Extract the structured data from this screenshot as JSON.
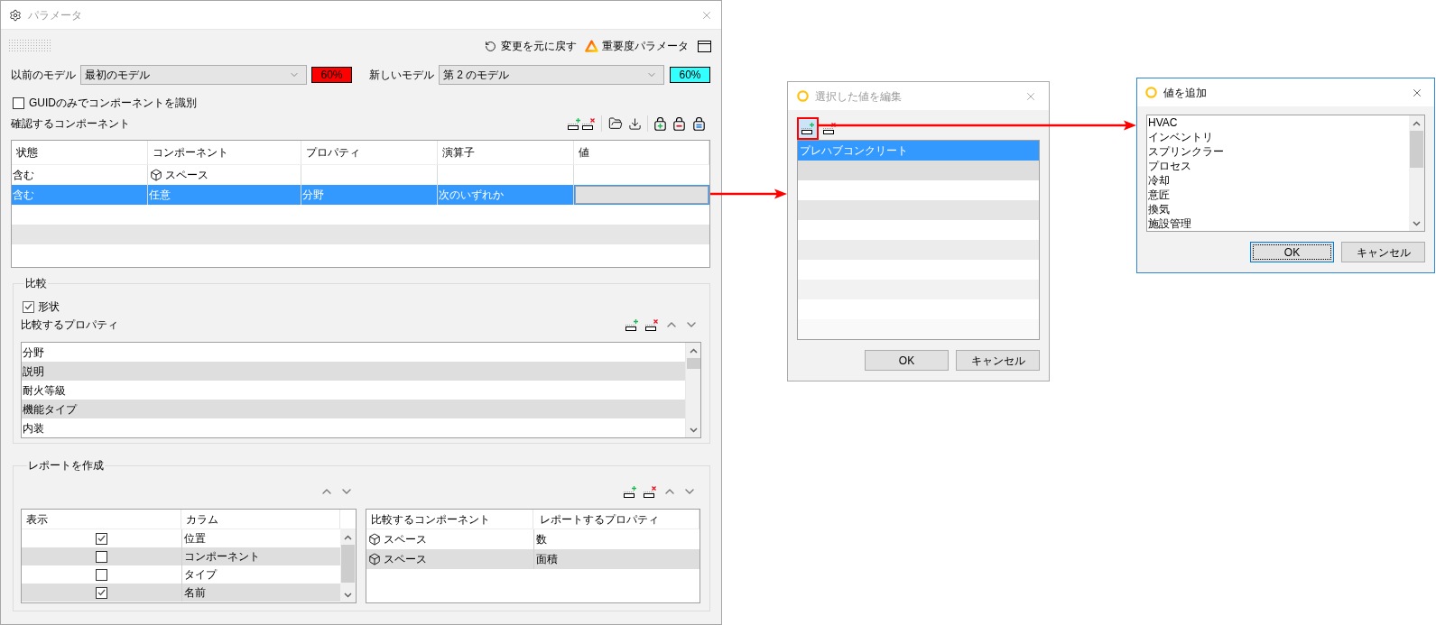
{
  "main_window": {
    "title": "パラメータ",
    "active": false,
    "toolbar": {
      "undo": "変更を元に戻す",
      "importance": "重要度パラメータ"
    },
    "models": [
      {
        "label": "以前のモデル",
        "value": "最初のモデル",
        "badge": "60%",
        "color": "#ff0000"
      },
      {
        "label": "新しいモデル",
        "value": "第 2 のモデル",
        "badge": "60%",
        "color": "#33ffff"
      }
    ],
    "guid_only": {
      "label": "GUIDのみでコンポーネントを識別",
      "checked": false
    },
    "components": {
      "title": "確認するコンポーネント",
      "columns": [
        "状態",
        "コンポーネント",
        "プロパティ",
        "演算子",
        "値"
      ],
      "rows": [
        {
          "status": "含む",
          "kind": "element",
          "component": "スペース",
          "selected": false,
          "editing": false
        },
        {
          "status": "含む",
          "kind": "any",
          "component": "任意",
          "property": "分野",
          "operator": "次のいずれか",
          "selected": true,
          "editing": true
        }
      ]
    },
    "comparison": {
      "title": "比較",
      "shape": {
        "label": "形状",
        "checked": true
      },
      "properties_title": "比較するプロパティ",
      "properties": [
        {
          "text": "分野",
          "selected": false
        },
        {
          "text": "説明",
          "selected": false
        },
        {
          "text": "耐火等級",
          "selected": false
        },
        {
          "text": "機能タイプ",
          "selected": false
        },
        {
          "text": "内装",
          "selected": false
        }
      ]
    },
    "report": {
      "title": "レポートを作成",
      "columns_table": {
        "columns": [
          "表示",
          "カラム"
        ],
        "rows": [
          {
            "name": "位置",
            "checked": true,
            "selected": false
          },
          {
            "name": "コンポーネント",
            "checked": false,
            "selected": false
          },
          {
            "name": "タイプ",
            "checked": false,
            "selected": false
          },
          {
            "name": "名前",
            "checked": true,
            "selected": false
          }
        ]
      },
      "components_table": {
        "columns": [
          "比較するコンポーネント",
          "レポートするプロパティ"
        ],
        "rows": [
          {
            "component": "スペース",
            "property": "数",
            "selected": false
          },
          {
            "component": "スペース",
            "property": "面積",
            "selected": false
          }
        ]
      }
    }
  },
  "edit_dialog": {
    "title": "選択した値を編集",
    "active": false,
    "tools": [
      {
        "kind": "add",
        "highlighted": true
      },
      {
        "kind": "remove",
        "highlighted": false
      }
    ],
    "values": [
      {
        "text": "プレハブコンクリート",
        "selected": true
      }
    ],
    "buttons": [
      {
        "label": "OK",
        "default": false
      },
      {
        "label": "キャンセル",
        "default": false
      }
    ]
  },
  "add_dialog": {
    "title": "値を追加",
    "active": true,
    "options": [
      {
        "text": "HVAC",
        "selected": false
      },
      {
        "text": "インベントリ",
        "selected": false
      },
      {
        "text": "スプリンクラー",
        "selected": false
      },
      {
        "text": "プロセス",
        "selected": false
      },
      {
        "text": "冷却",
        "selected": false
      },
      {
        "text": "意匠",
        "selected": false
      },
      {
        "text": "換気",
        "selected": false
      },
      {
        "text": "施設管理",
        "selected": false
      }
    ],
    "buttons": [
      {
        "label": "OK",
        "default": true
      },
      {
        "label": "キャンセル",
        "default": false
      }
    ]
  }
}
